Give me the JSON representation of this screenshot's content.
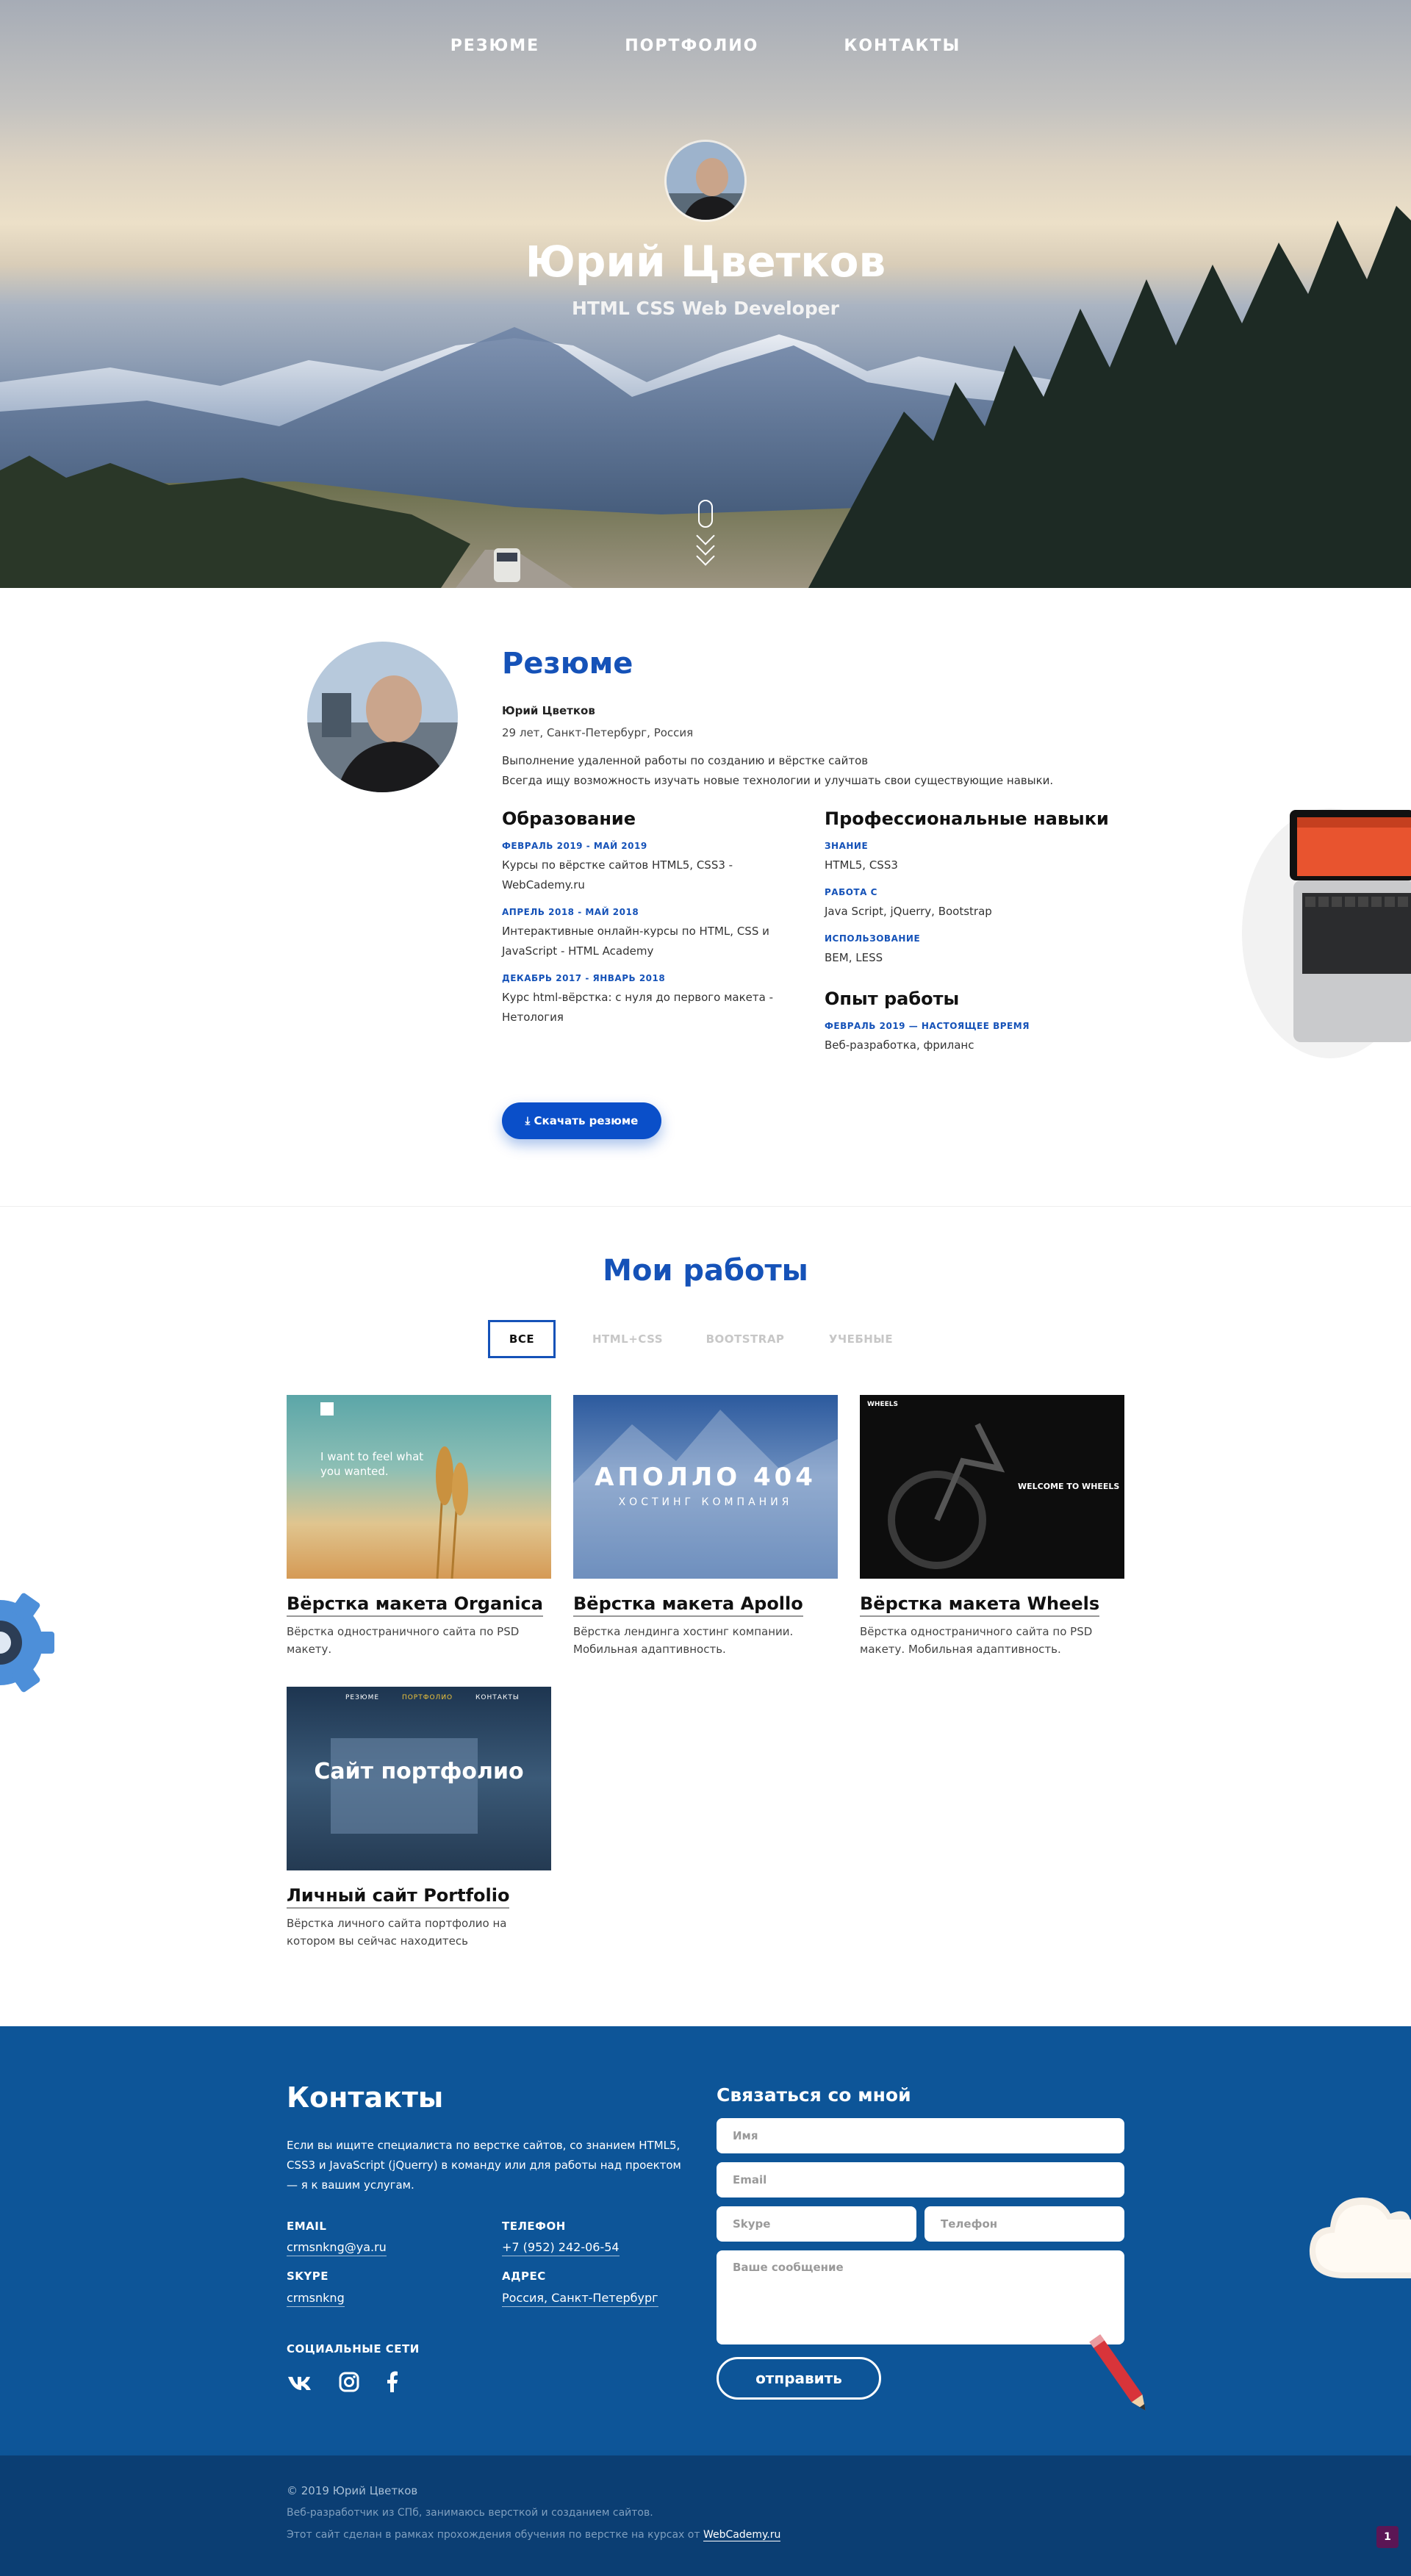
{
  "nav": {
    "items": [
      "РЕЗЮМЕ",
      "ПОРТФОЛИО",
      "КОНТАКТЫ"
    ]
  },
  "hero": {
    "name": "Юрий Цветков",
    "role": "HTML CSS Web Developer"
  },
  "resume": {
    "title": "Резюме",
    "name": "Юрий Цветков",
    "age_city": "29 лет, Санкт-Петербург, Россия",
    "desc1": "Выполнение удаленной работы по созданию и вёрстке сайтов",
    "desc2": "Всегда ищу возможность изучать новые технологии и улучшать свои существующие навыки.",
    "education": {
      "title": "Образование",
      "items": [
        {
          "date": "ФЕВРАЛЬ 2019 - МАЙ 2019",
          "text1": "Курсы по вёрстке сайтов HTML5, CSS3 -",
          "text2": "WebCademy.ru"
        },
        {
          "date": "АПРЕЛЬ 2018 - МАЙ 2018",
          "text1": "Интерактивные онлайн-курсы по HTML, CSS и",
          "text2": "JavaScript - HTML Academy"
        },
        {
          "date": "ДЕКАБРЬ 2017 - ЯНВАРЬ 2018",
          "text1": "Курс html-вёрстка: с нуля до первого макета -",
          "text2": "Нетология"
        }
      ]
    },
    "skills": {
      "title": "Профессиональные навыки",
      "items": [
        {
          "date": "ЗНАНИЕ",
          "text": "HTML5, CSS3"
        },
        {
          "date": "РАБОТА С",
          "text": "Java Script, jQuerry, Bootstrap"
        },
        {
          "date": "ИСПОЛЬЗОВАНИЕ",
          "text": "BEM, LESS"
        }
      ]
    },
    "experience": {
      "title": "Опыт работы",
      "date": "ФЕВРАЛЬ 2019 — НАСТОЯЩЕЕ ВРЕМЯ",
      "text": "Веб-разработка, фриланс"
    },
    "download_label": "Скачать резюме"
  },
  "portfolio": {
    "title": "Мои работы",
    "filters": [
      "ВСЕ",
      "HTML+CSS",
      "BOOTSTRAP",
      "УЧЕБНЫЕ"
    ],
    "cards": [
      {
        "title": "Вёрстка макета Organica",
        "desc": "Вёрстка одностраничного сайта по PSD макету.",
        "thumb_text": "I want to feel what you wanted."
      },
      {
        "title": "Вёрстка макета Apollo",
        "desc": "Вёрстка лендинга хостинг компании. Мобильная адаптивность.",
        "thumb_text": "АПОЛЛО 404",
        "thumb_sub": "ХОСТИНГ КОМПАНИЯ"
      },
      {
        "title": "Вёрстка макета Wheels",
        "desc": "Вёрстка одностраничного сайта по PSD макету. Мобильная адаптивность.",
        "thumb_text": "WELCOME TO WHEELS",
        "thumb_brand": "WHEELS"
      },
      {
        "title": "Личный сайт Portfolio",
        "desc": "Вёрстка личного сайта портфолио на котором вы сейчас находитесь",
        "thumb_text": "Сайт портфолио",
        "thumb_nav": [
          "РЕЗЮМЕ",
          "ПОРТФОЛИО",
          "КОНТАКТЫ"
        ]
      }
    ]
  },
  "contacts": {
    "title": "Контакты",
    "intro": "Если вы ищите специалиста по верстке сайтов, со знанием HTML5, CSS3 и JavaScript (jQuerry) в команду или для работы над проектом — я к вашим услугам.",
    "email_label": "EMAIL",
    "email": "crmsnkng@ya.ru",
    "phone_label": "ТЕЛЕФОН",
    "phone": "+7 (952) 242-06-54",
    "skype_label": "SKYPE",
    "skype": "crmsnkng",
    "address_label": "АДРЕС",
    "address": "Россия, Санкт-Петербург",
    "social_label": "СОЦИАЛЬНЫЕ СЕТИ",
    "form": {
      "title": "Связаться со мной",
      "name_ph": "Имя",
      "email_ph": "Email",
      "skype_ph": "Skype",
      "phone_ph": "Телефон",
      "message_ph": "Ваше сообщение",
      "submit": "отправить"
    }
  },
  "footer": {
    "copyright": "© 2019 Юрий Цветков",
    "line2": "Веб-разработчик из СПб, занимаюсь версткой и созданием сайтов.",
    "line3": "Этот сайт сделан в рамках прохождения обучения по верстке на курсах от",
    "link": "WebCademy.ru",
    "badge": "1"
  },
  "colors": {
    "accent": "#1552b8",
    "button": "#0a4fc9",
    "contacts_bg": "#0d5598",
    "footer_bg": "#0b3e73"
  }
}
